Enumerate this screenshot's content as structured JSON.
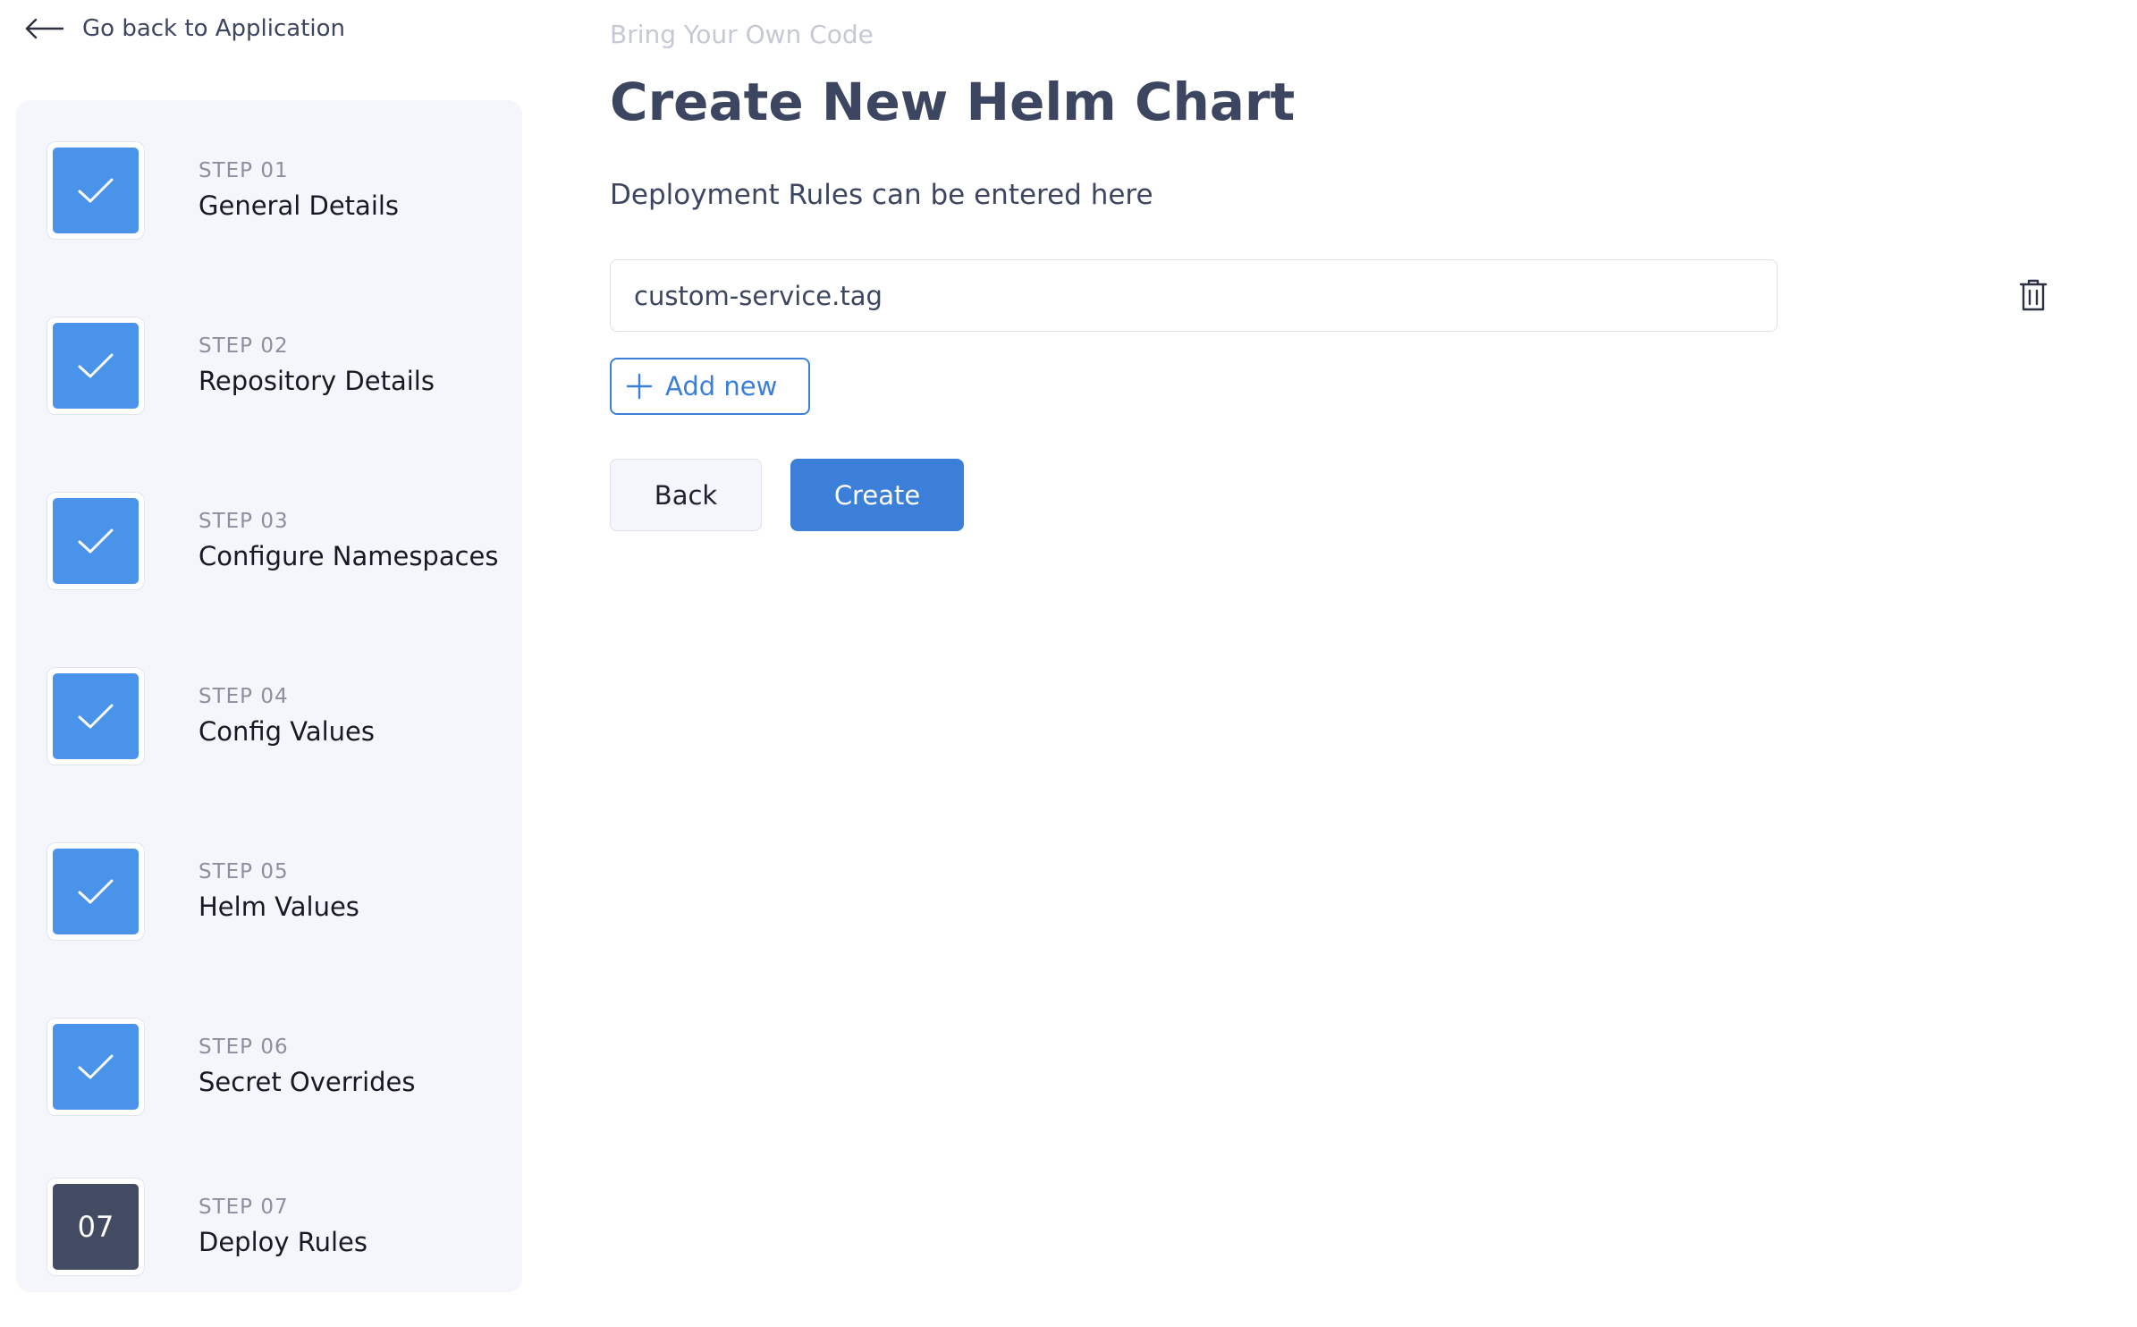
{
  "nav": {
    "back_label": "Go back to Application",
    "back_icon": "arrow-left-icon"
  },
  "steps": [
    {
      "kicker": "STEP 01",
      "title": "General Details",
      "status": "complete"
    },
    {
      "kicker": "STEP 02",
      "title": "Repository Details",
      "status": "complete"
    },
    {
      "kicker": "STEP 03",
      "title": "Configure Namespaces",
      "status": "complete"
    },
    {
      "kicker": "STEP 04",
      "title": "Config Values",
      "status": "complete"
    },
    {
      "kicker": "STEP 05",
      "title": "Helm Values",
      "status": "complete"
    },
    {
      "kicker": "STEP 06",
      "title": "Secret Overrides",
      "status": "complete"
    },
    {
      "kicker": "STEP 07",
      "title": "Deploy Rules",
      "status": "current",
      "number": "07"
    }
  ],
  "main": {
    "eyebrow": "Bring Your Own Code",
    "title": "Create New Helm Chart",
    "section_label": "Deployment Rules can be entered here",
    "rules": [
      {
        "value": "custom-service.tag"
      }
    ],
    "add_new_label": "Add new",
    "back_button": "Back",
    "create_button": "Create"
  },
  "colors": {
    "accent": "#3b7fd9",
    "step_complete": "#4a93ea",
    "step_current": "#434b62",
    "sidebar_bg": "#f5f6fb",
    "heading": "#3d4660"
  }
}
